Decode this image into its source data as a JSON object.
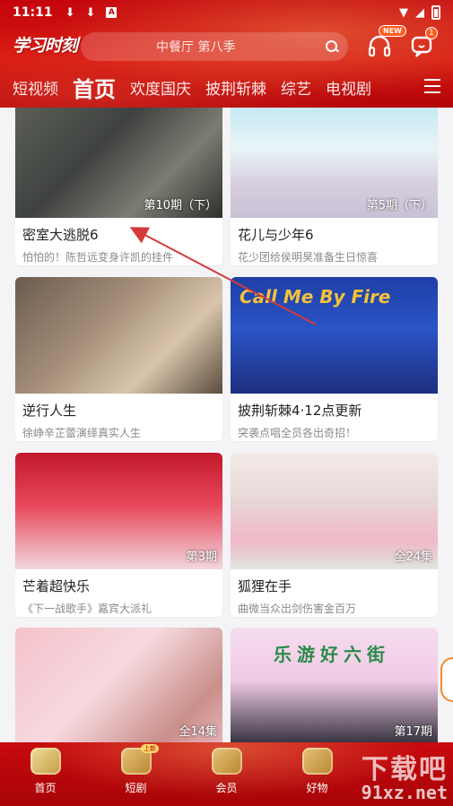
{
  "status_bar": {
    "time": "11:11",
    "letter": "A"
  },
  "header": {
    "logo": "学习时刻",
    "search_placeholder": "中餐厅 第八季",
    "listen_badge": "NEW",
    "message_badge": "1"
  },
  "tabs": [
    {
      "label": "短视频",
      "active": false
    },
    {
      "label": "首页",
      "active": true
    },
    {
      "label": "欢度国庆",
      "active": false
    },
    {
      "label": "披荆斩棘",
      "active": false
    },
    {
      "label": "综艺",
      "active": false
    },
    {
      "label": "电视剧",
      "active": false
    }
  ],
  "cards": [
    {
      "title": "密室大逃脱6",
      "subtitle": "怕怕的！陈哲远变身许凯的挂件",
      "episode": "第10期（下）",
      "overlay_text": ""
    },
    {
      "title": "花儿与少年6",
      "subtitle": "花少团给侯明昊准备生日惊喜",
      "episode": "第5期（下）",
      "overlay_text": ""
    },
    {
      "title": "逆行人生",
      "subtitle": "徐峥辛芷蕾演绎真实人生",
      "episode": "",
      "overlay_text": ""
    },
    {
      "title": "披荆斩棘4·12点更新",
      "subtitle": "突袭点唱全员各出奇招！",
      "episode": "",
      "overlay_text": "Call Me By Fire"
    },
    {
      "title": "芒着超快乐",
      "subtitle": "《下一战歌手》嘉宾大派礼",
      "episode": "第3期",
      "overlay_text": ""
    },
    {
      "title": "狐狸在手",
      "subtitle": "曲微当众出剑伤害金百万",
      "episode": "全24集",
      "overlay_text": ""
    },
    {
      "title": "",
      "subtitle": "",
      "episode": "全14集",
      "overlay_text": ""
    },
    {
      "title": "",
      "subtitle": "",
      "episode": "第17期",
      "overlay_text": "乐游好六街"
    }
  ],
  "bottom_nav": [
    {
      "label": "首页",
      "active": true
    },
    {
      "label": "短剧",
      "active": false,
      "badge": "上新"
    },
    {
      "label": "会员",
      "active": false
    },
    {
      "label": "好物",
      "active": false
    }
  ],
  "watermark": {
    "line1": "下载吧",
    "line2": "91xz.net"
  },
  "colors": {
    "brand_red": "#c4060c",
    "accent_orange": "#ff5a1f"
  }
}
